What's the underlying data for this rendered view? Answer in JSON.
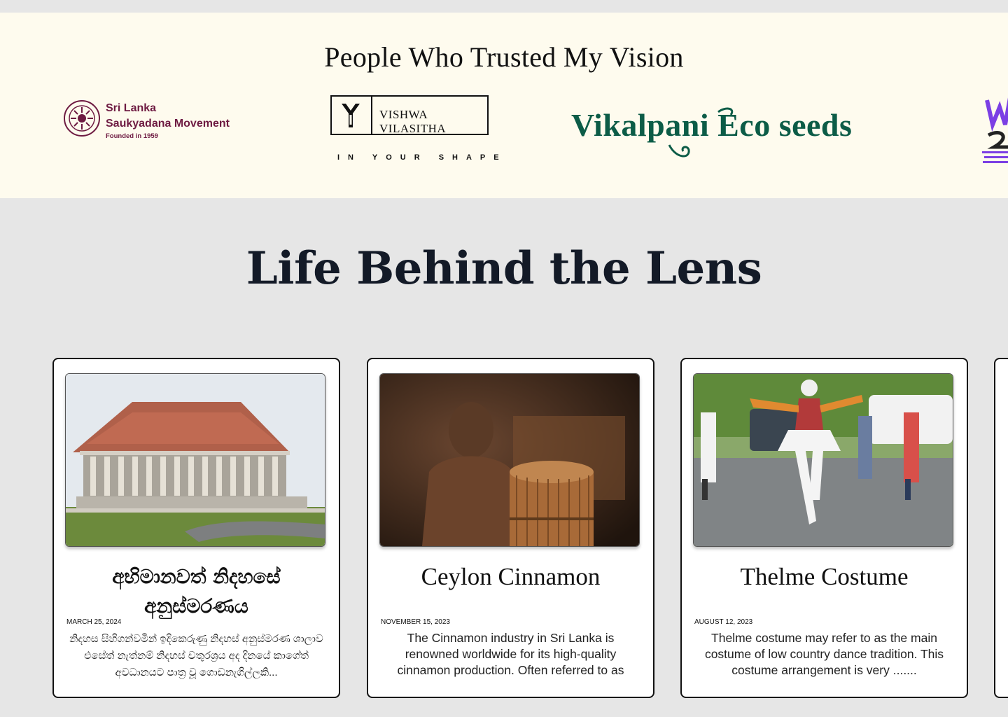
{
  "trusted": {
    "title": "People Who Trusted My Vision",
    "logos": [
      {
        "name": "Sri Lanka Saukyadana Movement",
        "line1": "Sri Lanka",
        "line2": "Saukyadana Movement",
        "line3": "Founded in 1959",
        "color": "#6e1b42"
      },
      {
        "name": "Vishwa Vilasitha",
        "text": "VISHWA VILASITHA",
        "tagline": "IN YOUR SHAPE",
        "color": "#111111"
      },
      {
        "name": "Vikalpani Eco seeds",
        "text": "Vikalpani Eco seeds",
        "color": "#0c5c47"
      },
      {
        "name": "Vikalpani partial",
        "color": "#7b3fe4"
      }
    ]
  },
  "lens": {
    "title": "Life Behind the Lens",
    "cards": [
      {
        "title": "අභිමානවත් නිදහසේ අනුස්මරණය",
        "date": "MARCH 25, 2024",
        "excerpt": "නිදහස සිහිගන්වමින් ඉදිකෙරුණු නිදහස් අනුස්මරණ ශාලාව එසේත් නැත්නම් නිදහස් චතුරශ්‍රය අද දිනයේ කාගේත් අවධානයට පාත්‍ර වූ ගොඩනැගිල්ලකි..."
      },
      {
        "title": "Ceylon Cinnamon",
        "date": "NOVEMBER 15, 2023",
        "excerpt": "The Cinnamon industry in Sri Lanka is renowned worldwide for its high-quality cinnamon production. Often referred to as"
      },
      {
        "title": "Thelme Costume",
        "date": "AUGUST 12, 2023",
        "excerpt": "Thelme costume may refer to as the main costume of low country dance tradition. This costume arrangement is very ......."
      }
    ]
  }
}
